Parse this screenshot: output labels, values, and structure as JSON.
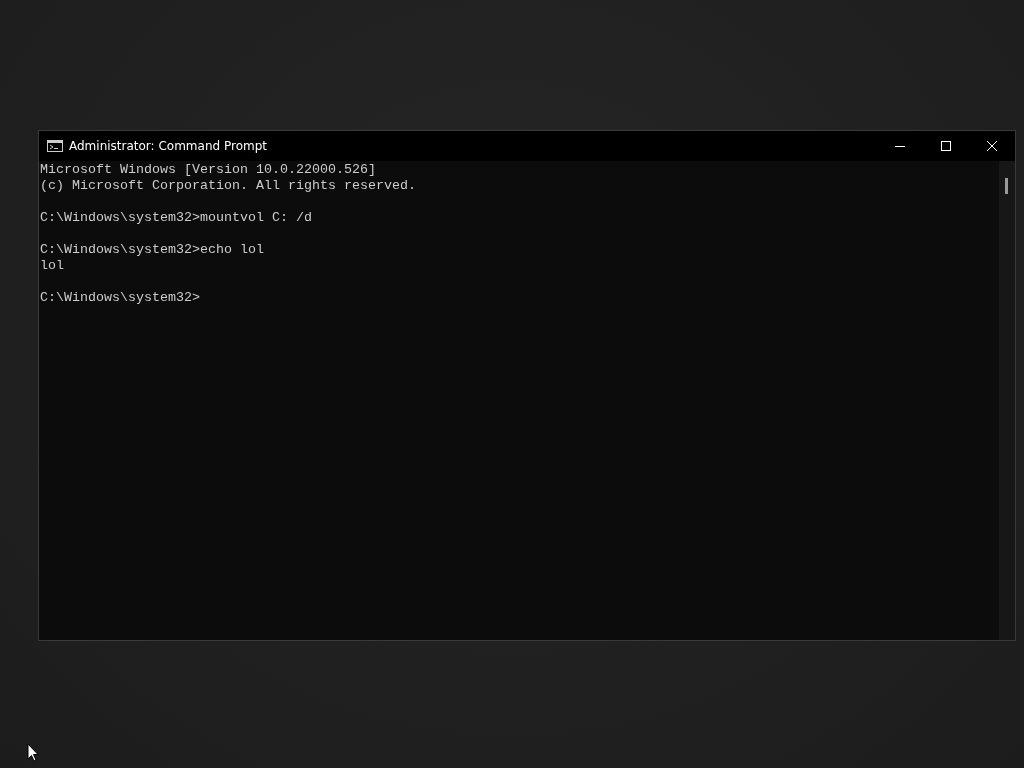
{
  "window": {
    "title": "Administrator: Command Prompt"
  },
  "console": {
    "blocks": [
      [
        "Microsoft Windows [Version 10.0.22000.526]",
        "(c) Microsoft Corporation. All rights reserved."
      ],
      [
        "C:\\Windows\\system32>mountvol C: /d"
      ],
      [
        "C:\\Windows\\system32>echo lol",
        "lol"
      ],
      [
        "C:\\Windows\\system32>"
      ]
    ]
  }
}
